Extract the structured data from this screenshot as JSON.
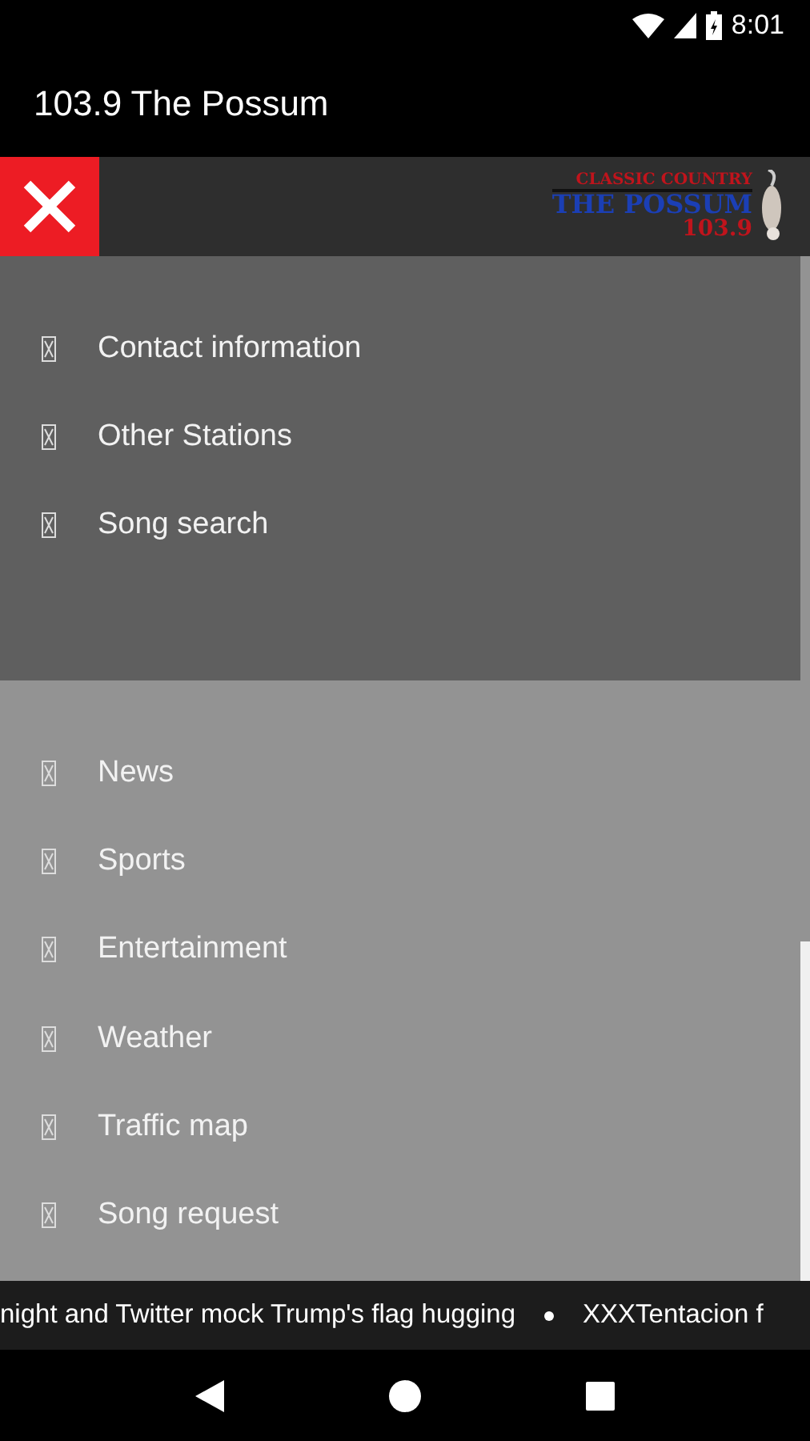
{
  "status_bar": {
    "time": "8:01"
  },
  "app_bar": {
    "title": "103.9 The Possum"
  },
  "drawer_header": {
    "logo": {
      "line_1": "CLASSIC COUNTRY",
      "line_2": "THE POSSUM",
      "line_3": "103.9"
    }
  },
  "menu_sections": [
    {
      "items": [
        {
          "label": "Contact information"
        },
        {
          "label": "Other Stations"
        },
        {
          "label": "Song search"
        }
      ]
    },
    {
      "items": [
        {
          "label": "News"
        },
        {
          "label": "Sports"
        },
        {
          "label": "Entertainment"
        },
        {
          "label": "Weather"
        },
        {
          "label": "Traffic map"
        },
        {
          "label": "Song request"
        }
      ]
    }
  ],
  "ticker": {
    "items": [
      "night and Twitter mock Trump's flag hugging",
      "XXXTentacion f"
    ]
  }
}
